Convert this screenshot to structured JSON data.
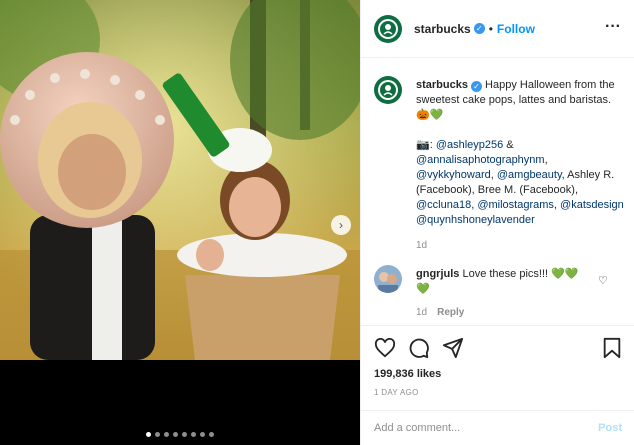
{
  "post": {
    "account": "starbucks",
    "follow_label": "Follow",
    "more_icon": "more-horizontal-icon",
    "caption_intro": "Happy Halloween from the sweetest cake pops, lattes and baristas. 🎃💚",
    "caption_credit_prefix": "📷: ",
    "mentions": [
      "@ashleyp256",
      "@annalisaphotographynm",
      "@vykkyhoward",
      "@amgbeauty",
      "@ccluna18",
      "@milostagrams",
      "@katsdesign",
      "@quynhshoneylavender"
    ],
    "caption_credit_text_1": " & ",
    "caption_credit_text_2": ", ",
    "caption_credit_text_3": ", ",
    "caption_credit_text_4": ", Ashley R. (Facebook), Bree M. (Facebook), ",
    "caption_credit_text_5": ", ",
    "caption_credit_text_6": ", ",
    "caption_credit_text_7": " ",
    "caption_age": "1d",
    "comment": {
      "user": "gngrjuls",
      "text": "Love these pics!!! 💚💚",
      "text_line2": "💚",
      "age": "1d",
      "reply_label": "Reply"
    },
    "likes": "199,836 likes",
    "posted_ago": "1 DAY AGO",
    "comment_placeholder": "Add a comment...",
    "post_label": "Post"
  },
  "media": {
    "slides_total": 8,
    "slide_active": 1
  },
  "colors": {
    "brand_green": "#0f6d42",
    "link_blue": "#0095f6",
    "verified_blue": "#3897f0",
    "mention_color": "#00376b"
  }
}
